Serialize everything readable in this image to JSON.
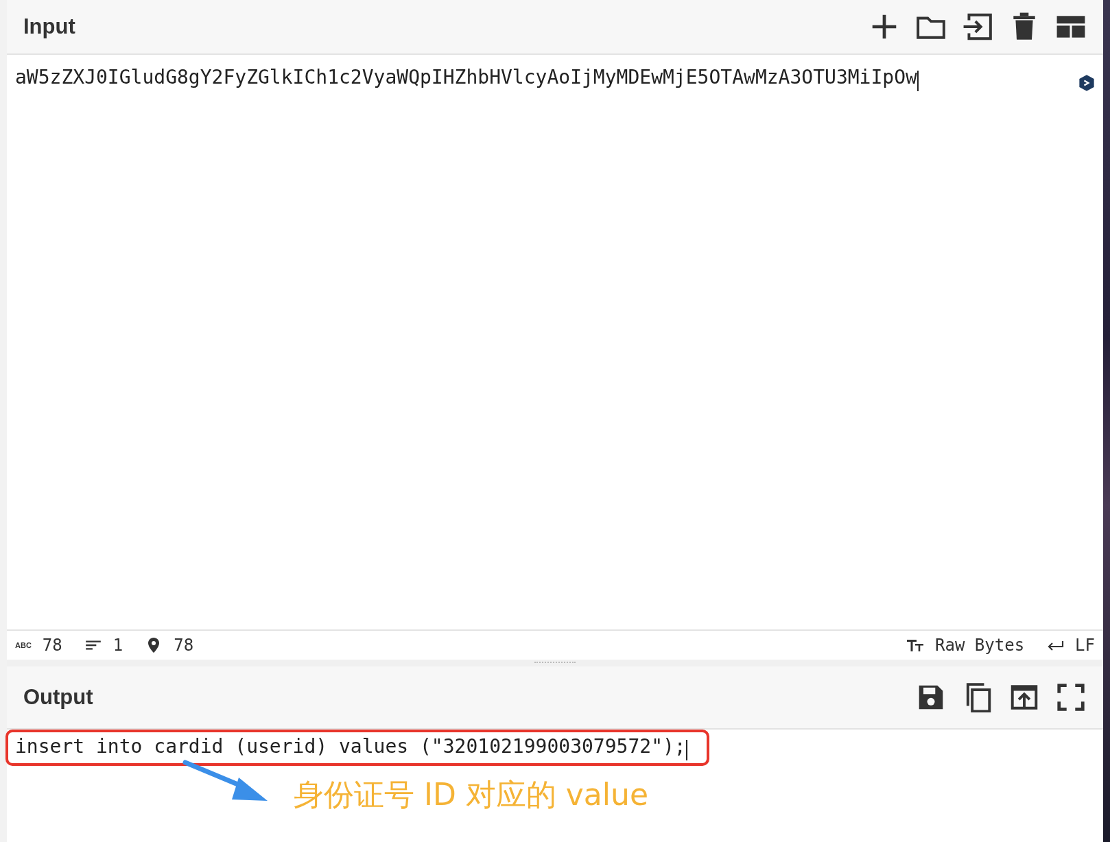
{
  "input": {
    "title": "Input",
    "text": "aW5zZXJ0IGludG8gY2FyZGlkICh1c2VyaWQpIHZhbHVlcyAoIjMyMDEwMjE5OTAwMzA3OTU3MiIpOw"
  },
  "status_bar": {
    "left": [
      {
        "kind": "chars",
        "icon_label": "ABC",
        "value": "78"
      },
      {
        "kind": "lines",
        "value": "1"
      },
      {
        "kind": "position",
        "value": "78"
      }
    ],
    "right": [
      {
        "kind": "format",
        "value": "Raw Bytes"
      },
      {
        "kind": "eol",
        "value": "LF"
      }
    ]
  },
  "output": {
    "title": "Output",
    "text": "insert into cardid (userid) values (\"320102199003079572\");"
  },
  "annotation": {
    "text": "身份证号 ID 对应的 value"
  }
}
